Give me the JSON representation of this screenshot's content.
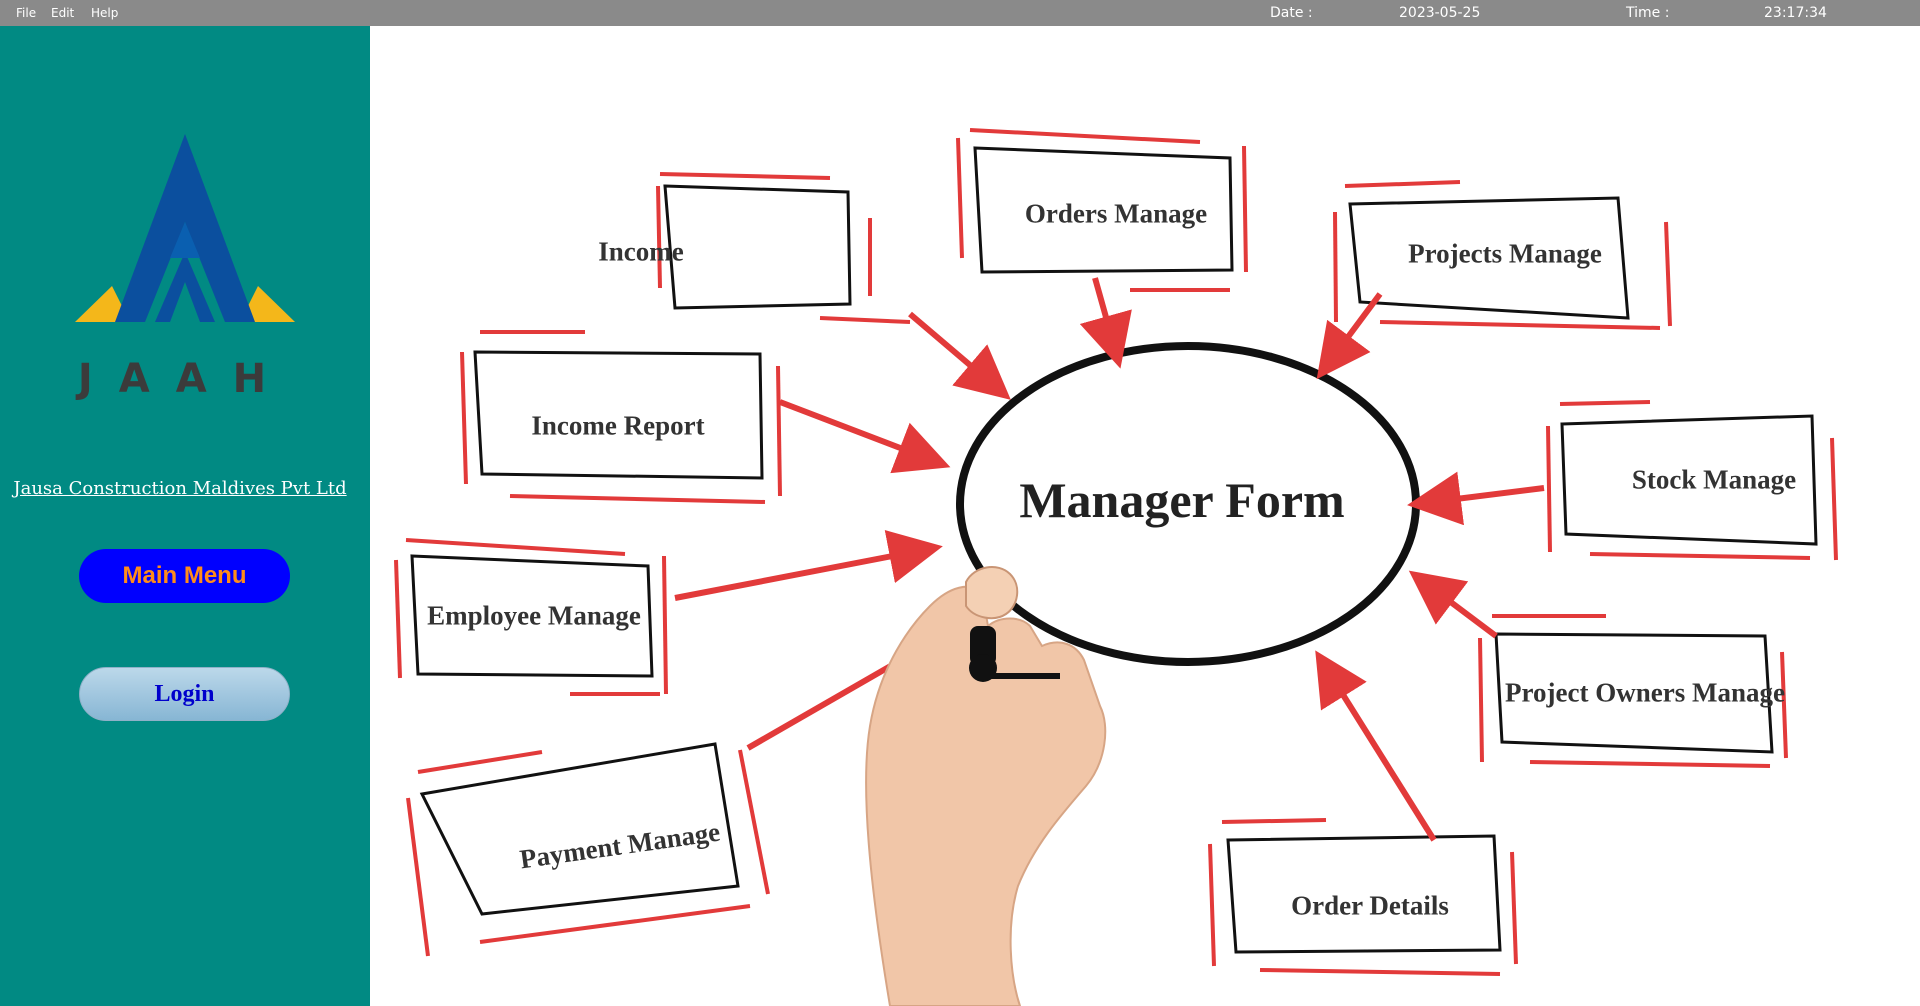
{
  "menubar": {
    "file": "File",
    "edit": "Edit",
    "help": "Help"
  },
  "status": {
    "date_label": "Date :",
    "date_value": "2023-05-25",
    "time_label": "Time :",
    "time_value": "23:17:34"
  },
  "sidebar": {
    "logo_text": "JAAH",
    "company_name": "Jausa Construction Maldives Pvt Ltd",
    "main_menu_label": "Main Menu",
    "login_label": "Login"
  },
  "mindmap": {
    "center": "Manager Form",
    "nodes": {
      "income": "Income",
      "orders_manage": "Orders Manage",
      "projects_manage": "Projects Manage",
      "income_report": "Income Report",
      "stock_manage": "Stock Manage",
      "employee_manage": "Employee Manage",
      "project_owners_manage": "Project Owners Manage",
      "payment_manage": "Payment Manage",
      "order_details": "Order Details"
    }
  },
  "colors": {
    "sidebar_bg": "#018a83",
    "topbar_bg": "#8a8a8a",
    "arrow_red": "#e23a3a",
    "main_menu_bg": "#0000ff",
    "main_menu_text": "#ff8c1a",
    "login_text": "#0000cc",
    "logo_blue": "#0b4f9e",
    "logo_yellow": "#f4b71a"
  }
}
